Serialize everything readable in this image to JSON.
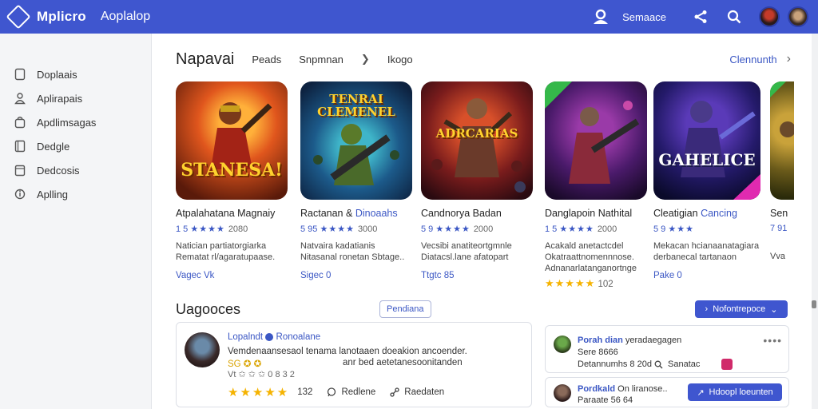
{
  "header": {
    "brand": "Mplicro",
    "app_title": "Aoplalop",
    "account_label": "Semaace"
  },
  "sidebar": {
    "items": [
      {
        "label": "Doplaais",
        "icon": "doc-icon"
      },
      {
        "label": "Aplirapais",
        "icon": "user-icon"
      },
      {
        "label": "Apdlimsagas",
        "icon": "bag-icon"
      },
      {
        "label": "Dedgle",
        "icon": "book-icon"
      },
      {
        "label": "Dedcosis",
        "icon": "calendar-icon"
      },
      {
        "label": "Aplling",
        "icon": "info-icon"
      }
    ]
  },
  "main": {
    "section_title": "Napavai",
    "tabs": [
      "Peads",
      "Snpmnan",
      "Ikogo"
    ],
    "see_all": "Clennunth"
  },
  "cards": [
    {
      "thumb_text": "STANESA!",
      "name": "Atpalahatana Magnaiy",
      "name_highlight": "",
      "rating_value": "1 5",
      "rating_count": "2080",
      "desc1": "Natician partiatorgiarka",
      "desc2": "Rematat rl/agaratupaase.",
      "price": "Vagec Vk"
    },
    {
      "thumb_text": "TENRAI CLEMENEL",
      "name": "Ractanan &",
      "name_highlight": "Dinoaahs",
      "rating_value": "5 95",
      "rating_count": "3000",
      "desc1": "Natvaira kadatianis",
      "desc2": "Nitasanal ronetan Sbtage..",
      "price": "Sigec 0"
    },
    {
      "thumb_text": "ADRCARIAS",
      "name": "Candnorya Badan",
      "name_highlight": "",
      "rating_value": "5 9",
      "rating_count": "2000",
      "desc1": "Vecsibi anatiteortgmnle",
      "desc2": "Diatacsl.lane afatopart",
      "price": "Ttgtc 85"
    },
    {
      "thumb_text": "",
      "name": "Danglapoin Nathital",
      "name_highlight": "",
      "rating_value": "1 5",
      "rating_count": "2000",
      "desc1": "Acakald anetactcdel",
      "desc2": "Okatraattnomennnose.",
      "desc3": "Adnanarlatanganortnge",
      "gold_count": "102",
      "price": ""
    },
    {
      "thumb_text": "GAHELICE",
      "name": "Cleatigian",
      "name_highlight": "Cancing",
      "rating_value": "5 9",
      "rating_count": "",
      "desc1": "Mekacan hcianaanatagiara",
      "desc2": "derbanecal tartanaon",
      "price": "Pake 0"
    },
    {
      "thumb_text": "",
      "name": "Sen",
      "name_highlight": "",
      "rating_value": "7 91",
      "rating_count": "",
      "desc1": "",
      "desc2": "Vva",
      "price": ""
    }
  ],
  "reviews": {
    "title": "Uagooces",
    "filter_label": "Pendiana",
    "action_label": "Nofontrepoce",
    "main": {
      "name": "Lopalndt",
      "name_tag": "Ronoalane",
      "text1": "Vemdenaansesaol tenama  lanotaaen doeakion ancoender.",
      "text2": "anr bed aetetanesoonitanden",
      "emoji": "SG ✪ ✪",
      "meta": "Vt ✩ ✩ ✩ 0 8 3 2",
      "count": "132",
      "action1": "Redlene",
      "action2": "Raedaten"
    },
    "side1": {
      "name": "Porah dian",
      "line1_rest": "yeradaegagen",
      "line2": "Sere 8666",
      "line3": "Detannumhs 8 20d",
      "action": "Sanatac"
    },
    "side2": {
      "name": "Pordkald",
      "line1_rest": "On  liranose..",
      "line2": "Paraate 56 64",
      "button": "Hdoopl  loeunten"
    }
  },
  "colors": {
    "brand_blue": "#3f56cf",
    "link_blue": "#3b57c4",
    "star_gold": "#f5b301"
  }
}
